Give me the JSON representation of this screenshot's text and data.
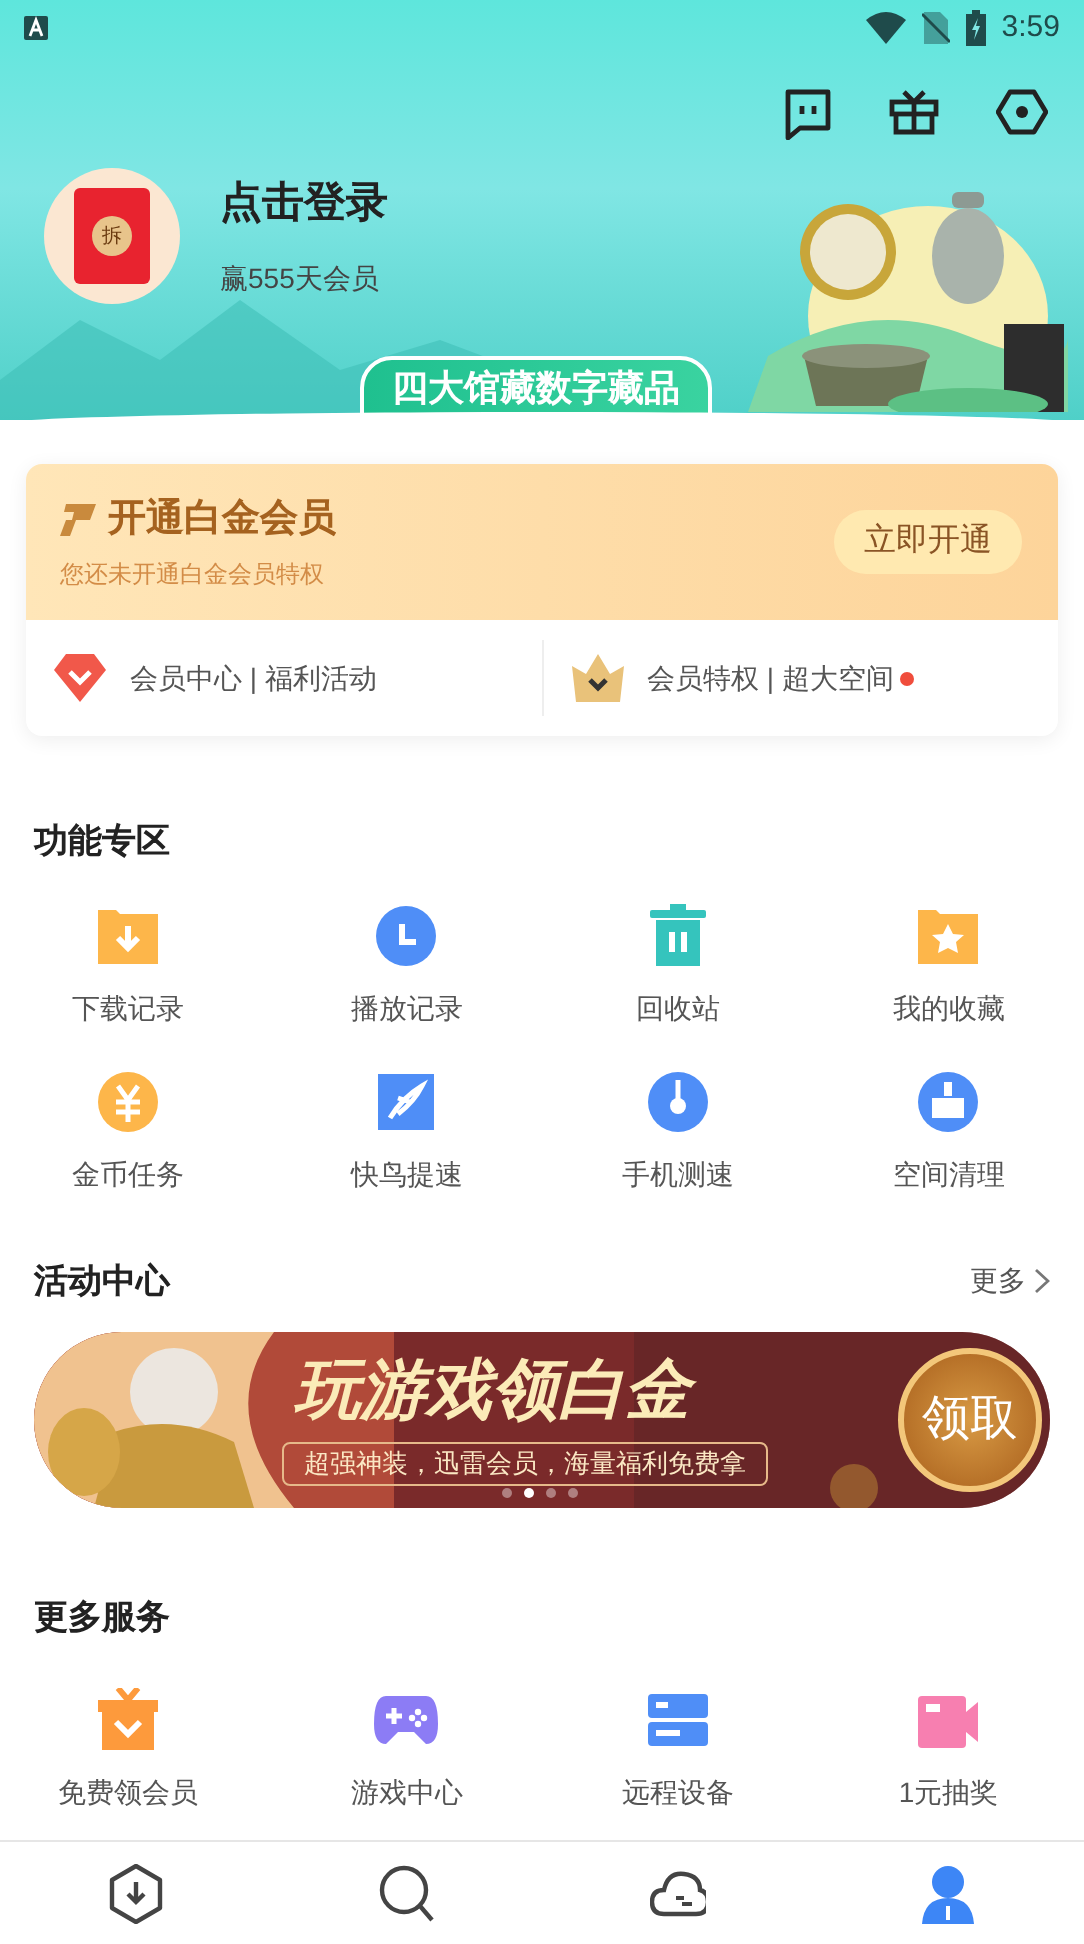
{
  "status_bar": {
    "time": "3:59"
  },
  "profile": {
    "avatar_text": "拆",
    "title": "点击登录",
    "subtitle": "赢555天会员",
    "promo_badge": "四大馆藏数字藏品"
  },
  "vip_card": {
    "title": "开通白金会员",
    "subtitle": "您还未开通白金会员特权",
    "button": "立即开通",
    "links": [
      {
        "kind": "heart",
        "label": "会员中心 | 福利活动",
        "dot": false
      },
      {
        "kind": "crown",
        "label": "会员特权 | 超大空间",
        "dot": true
      }
    ]
  },
  "features": {
    "title": "功能专区",
    "items": [
      {
        "kind": "download-folder",
        "label": "下载记录"
      },
      {
        "kind": "clock",
        "label": "播放记录"
      },
      {
        "kind": "trash",
        "label": "回收站"
      },
      {
        "kind": "star-folder",
        "label": "我的收藏"
      },
      {
        "kind": "coin",
        "label": "金币任务"
      },
      {
        "kind": "bird",
        "label": "快鸟提速"
      },
      {
        "kind": "gauge",
        "label": "手机测速"
      },
      {
        "kind": "broom",
        "label": "空间清理"
      }
    ]
  },
  "activity": {
    "title": "活动中心",
    "more": "更多",
    "banner": {
      "headline": "玩游戏领白金",
      "tagline": "超强神装，迅雷会员，海量福利免费拿",
      "button": "领取",
      "dots": [
        {
          "selected": false
        },
        {
          "selected": true
        },
        {
          "selected": false
        },
        {
          "selected": false
        }
      ]
    }
  },
  "services": {
    "title": "更多服务",
    "items": [
      {
        "kind": "gift",
        "label": "免费领会员"
      },
      {
        "kind": "gamepad",
        "label": "游戏中心"
      },
      {
        "kind": "server",
        "label": "远程设备"
      },
      {
        "kind": "video",
        "label": "1元抽奖"
      }
    ]
  },
  "bottom_nav": [
    {
      "kind": "download",
      "selected": false
    },
    {
      "kind": "search",
      "selected": false
    },
    {
      "kind": "cloud",
      "selected": false
    },
    {
      "kind": "person",
      "selected": true
    }
  ]
}
